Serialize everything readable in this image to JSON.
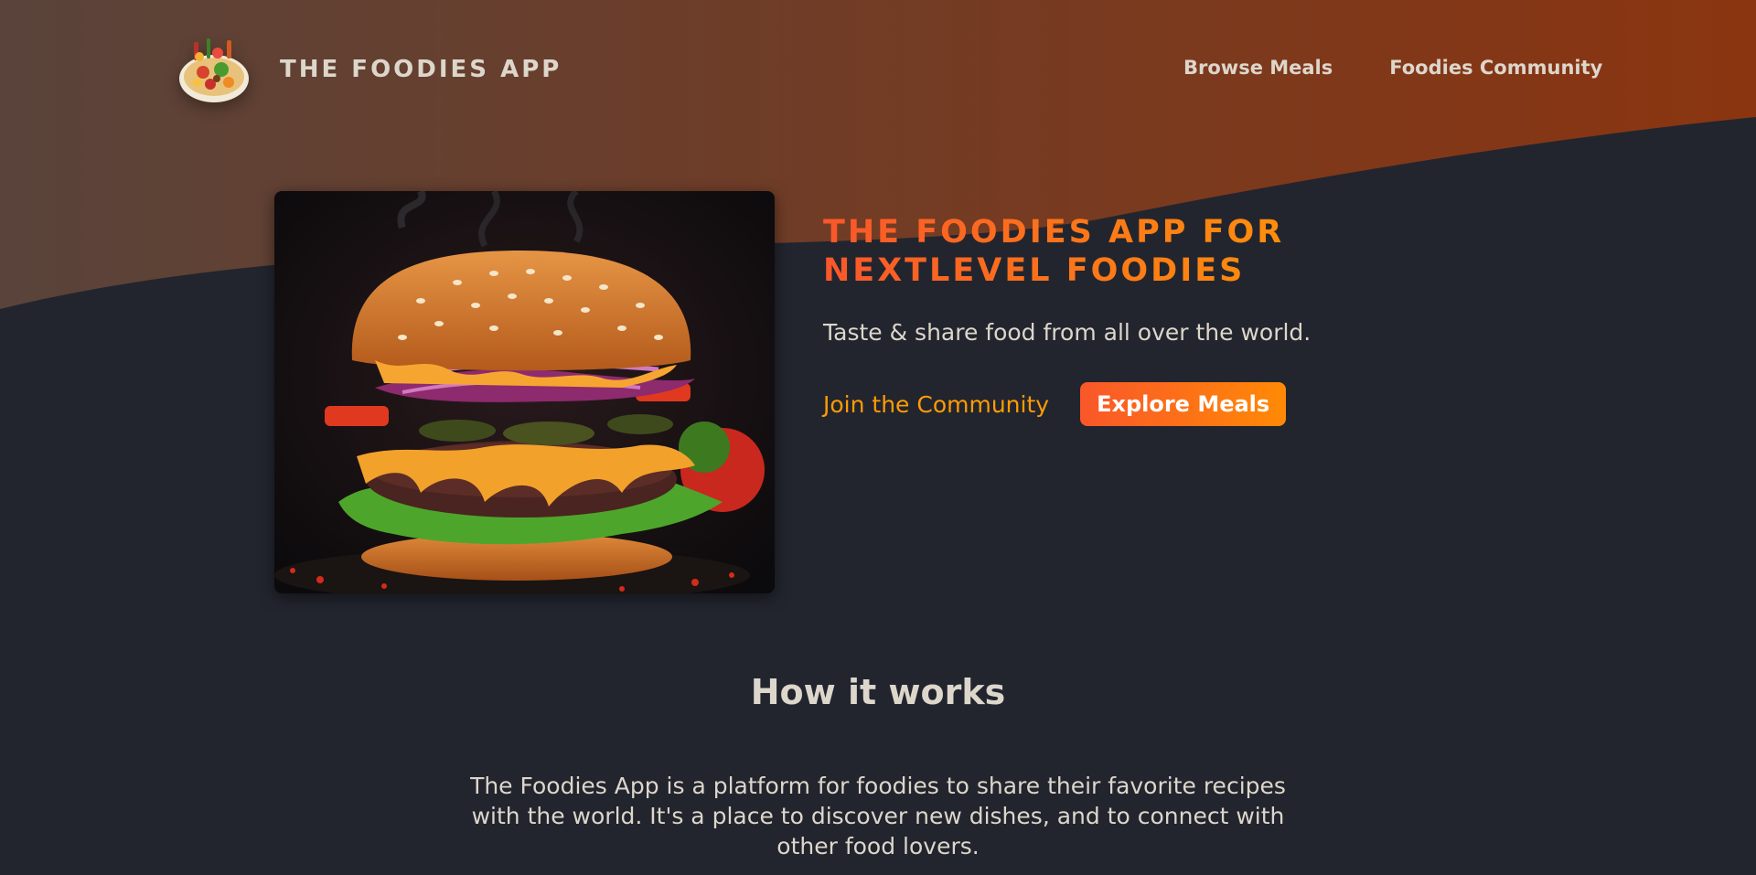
{
  "app": {
    "logo_text": "THE FOODIES APP",
    "logo_icon": "plate-of-food-icon"
  },
  "nav": {
    "items": [
      {
        "label": "Browse Meals"
      },
      {
        "label": "Foodies Community"
      }
    ]
  },
  "hero": {
    "image_icon": "burger-image",
    "title": "THE FOODIES APP FOR NEXTLEVEL FOODIES",
    "subtitle": "Taste & share food from all over the world.",
    "join_label": "Join the Community",
    "explore_label": "Explore Meals"
  },
  "how": {
    "title": "How it works",
    "text": "The Foodies App is a platform for foodies to share their favorite recipes with the world. It's a place to discover new dishes, and to connect with other food lovers."
  },
  "colors": {
    "background": "#22252e",
    "header_gradient_start": "#59433a",
    "header_gradient_end": "#8b3510",
    "accent_orange": "#ff9b05",
    "accent_red": "#f9572a",
    "text": "#ddd6cb"
  }
}
